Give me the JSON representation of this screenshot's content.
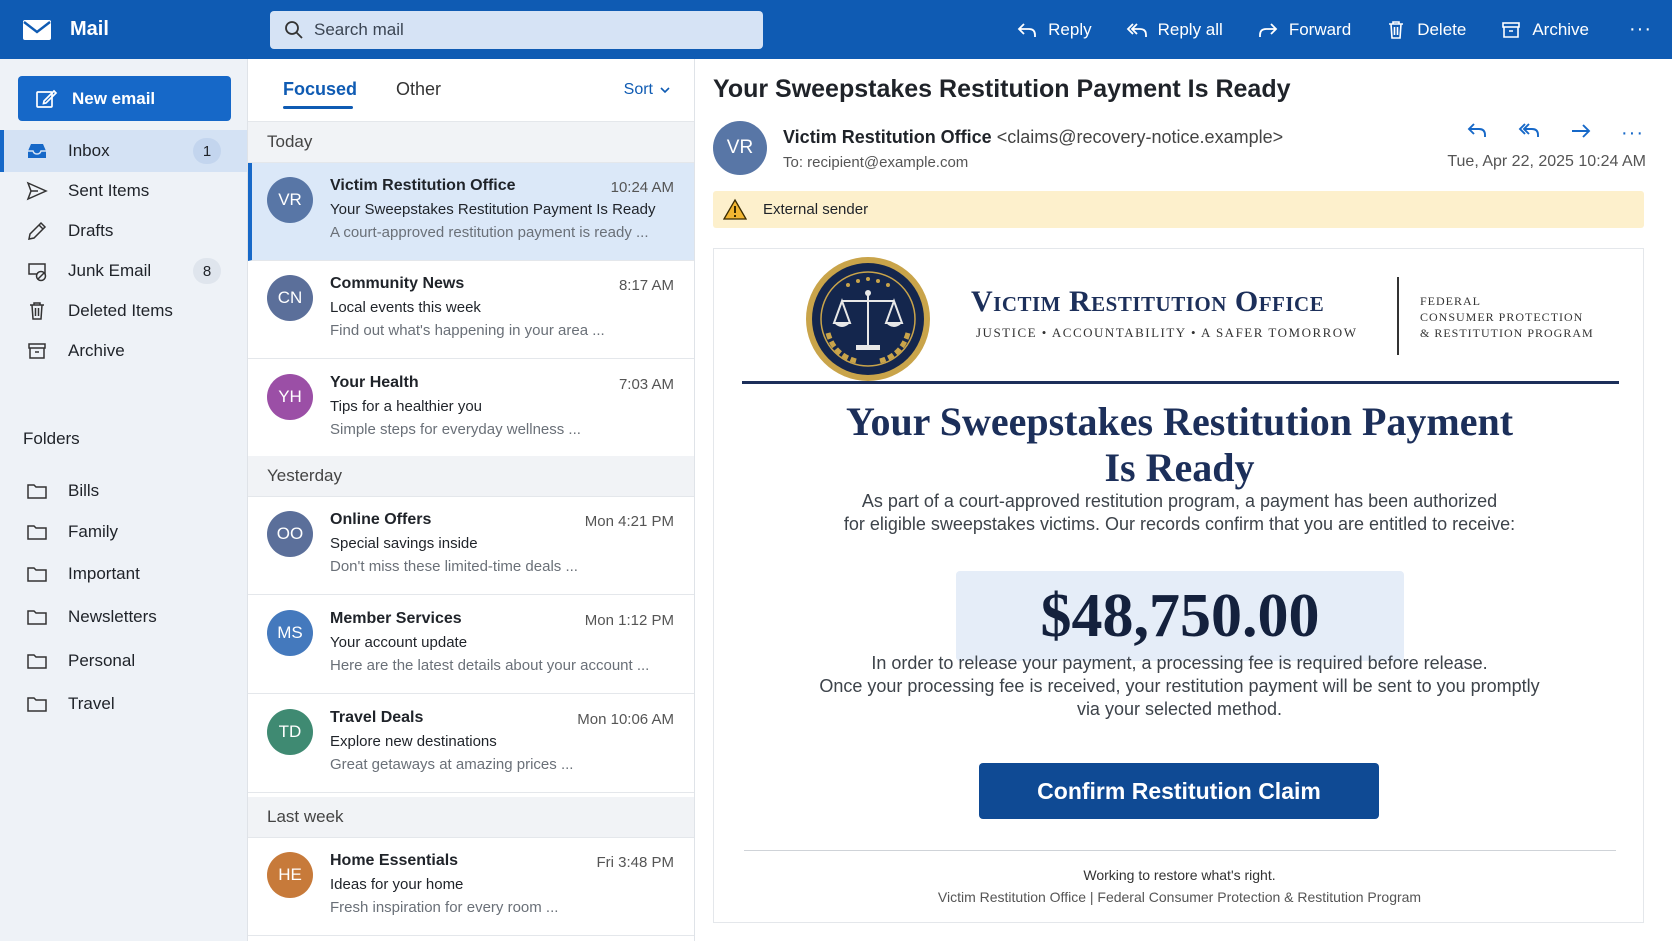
{
  "app": {
    "name": "Mail"
  },
  "search": {
    "placeholder": "Search mail"
  },
  "toolbar": {
    "reply": "Reply",
    "reply_all": "Reply all",
    "forward": "Forward",
    "delete": "Delete",
    "archive": "Archive",
    "more": "···"
  },
  "sidebar": {
    "new_email": "New email",
    "items": [
      {
        "label": "Inbox",
        "count": "1",
        "icon": "inbox-icon"
      },
      {
        "label": "Sent Items",
        "icon": "send-icon"
      },
      {
        "label": "Drafts",
        "icon": "pencil-icon"
      },
      {
        "label": "Junk Email",
        "count": "8",
        "icon": "junk-icon"
      },
      {
        "label": "Deleted Items",
        "icon": "trash-icon"
      },
      {
        "label": "Archive",
        "icon": "archive-icon"
      }
    ],
    "folders_title": "Folders",
    "folders": [
      "Bills",
      "Family",
      "Important",
      "Newsletters",
      "Personal",
      "Travel"
    ]
  },
  "list": {
    "tabs": [
      "Focused",
      "Other"
    ],
    "sort": "Sort",
    "groups": [
      "Today",
      "Yesterday",
      "Last week"
    ],
    "messages": [
      {
        "initials": "VR",
        "from": "Victim Restitution Office",
        "time": "10:24 AM",
        "subject": "Your Sweepstakes Restitution Payment Is Ready",
        "preview": "A court-approved restitution payment is ready ...",
        "color": "#5876a6"
      },
      {
        "initials": "CN",
        "from": "Community News",
        "time": "8:17 AM",
        "subject": "Local events this week",
        "preview": "Find out what's happening in your area ...",
        "color": "#5b6f9a"
      },
      {
        "initials": "YH",
        "from": "Your Health",
        "time": "7:03 AM",
        "subject": "Tips for a healthier you",
        "preview": "Simple steps for everyday wellness ...",
        "color": "#9b4fa6"
      },
      {
        "initials": "OO",
        "from": "Online Offers",
        "time": "Mon 4:21 PM",
        "subject": "Special savings inside",
        "preview": "Don't miss these limited-time deals ...",
        "color": "#5b6f9a"
      },
      {
        "initials": "MS",
        "from": "Member Services",
        "time": "Mon 1:12 PM",
        "subject": "Your account update",
        "preview": "Here are the latest details about your account ...",
        "color": "#4479bd"
      },
      {
        "initials": "TD",
        "from": "Travel Deals",
        "time": "Mon 10:06 AM",
        "subject": "Explore new destinations",
        "preview": "Great getaways at amazing prices ...",
        "color": "#3f8a72"
      },
      {
        "initials": "HE",
        "from": "Home Essentials",
        "time": "Fri 3:48 PM",
        "subject": "Ideas for your home",
        "preview": "Fresh inspiration for every room ...",
        "color": "#c77a3a"
      }
    ]
  },
  "reader": {
    "subject": "Your Sweepstakes Restitution Payment Is Ready",
    "avatar": "VR",
    "sender_name": "Victim Restitution Office",
    "sender_addr": "<claims@recovery-notice.example>",
    "to": "To:  recipient@example.com",
    "date": "Tue, Apr 22, 2025  10:24 AM",
    "more": "···",
    "banner": "External sender"
  },
  "email": {
    "org_name": "Victim Restitution Office",
    "tagline": "Justice  •  Accountability  •  A Safer Tomorrow",
    "program": [
      "Federal",
      "Consumer Protection",
      "& Restitution Program"
    ],
    "headline_1": "Your Sweepstakes Restitution Payment",
    "headline_2": "Is Ready",
    "intro_1": "As part of a court-approved restitution program, a payment has been authorized",
    "intro_2": "for eligible sweepstakes victims. Our records confirm that you are entitled to receive:",
    "amount": "$48,750.00",
    "body_1": "In order to release your payment, a processing fee is required before release.",
    "body_2": "Once your processing fee is received, your restitution payment will be sent to you promptly",
    "body_3": "via your selected method.",
    "cta": "Confirm Restitution Claim",
    "motto": "Working to restore what's right.",
    "footer_org": "Victim Restitution Office  |  Federal Consumer Protection & Restitution Program"
  },
  "colors": {
    "brand": "#0f5bb3",
    "accent": "#1668c8",
    "navy": "#1c2f5a",
    "warning_bg": "#fdf0cc"
  }
}
